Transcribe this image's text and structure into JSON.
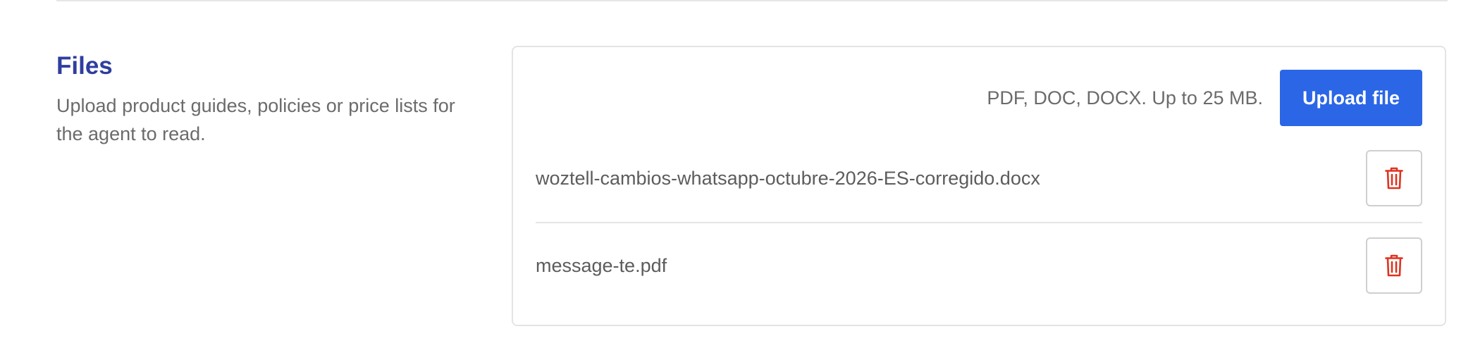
{
  "section": {
    "title": "Files",
    "description": "Upload product guides, policies or price lists for the agent to read."
  },
  "upload": {
    "hint": "PDF, DOC, DOCX. Up to 25 MB.",
    "button_label": "Upload file"
  },
  "files": [
    {
      "name": "woztell-cambios-whatsapp-octubre-2026-ES-corregido.docx",
      "delete_icon": "trash-icon"
    },
    {
      "name": "message-te.pdf",
      "delete_icon": "trash-icon"
    }
  ],
  "colors": {
    "title": "#2f3e9e",
    "primary_button": "#2b66e6",
    "delete_icon": "#e0321f"
  }
}
